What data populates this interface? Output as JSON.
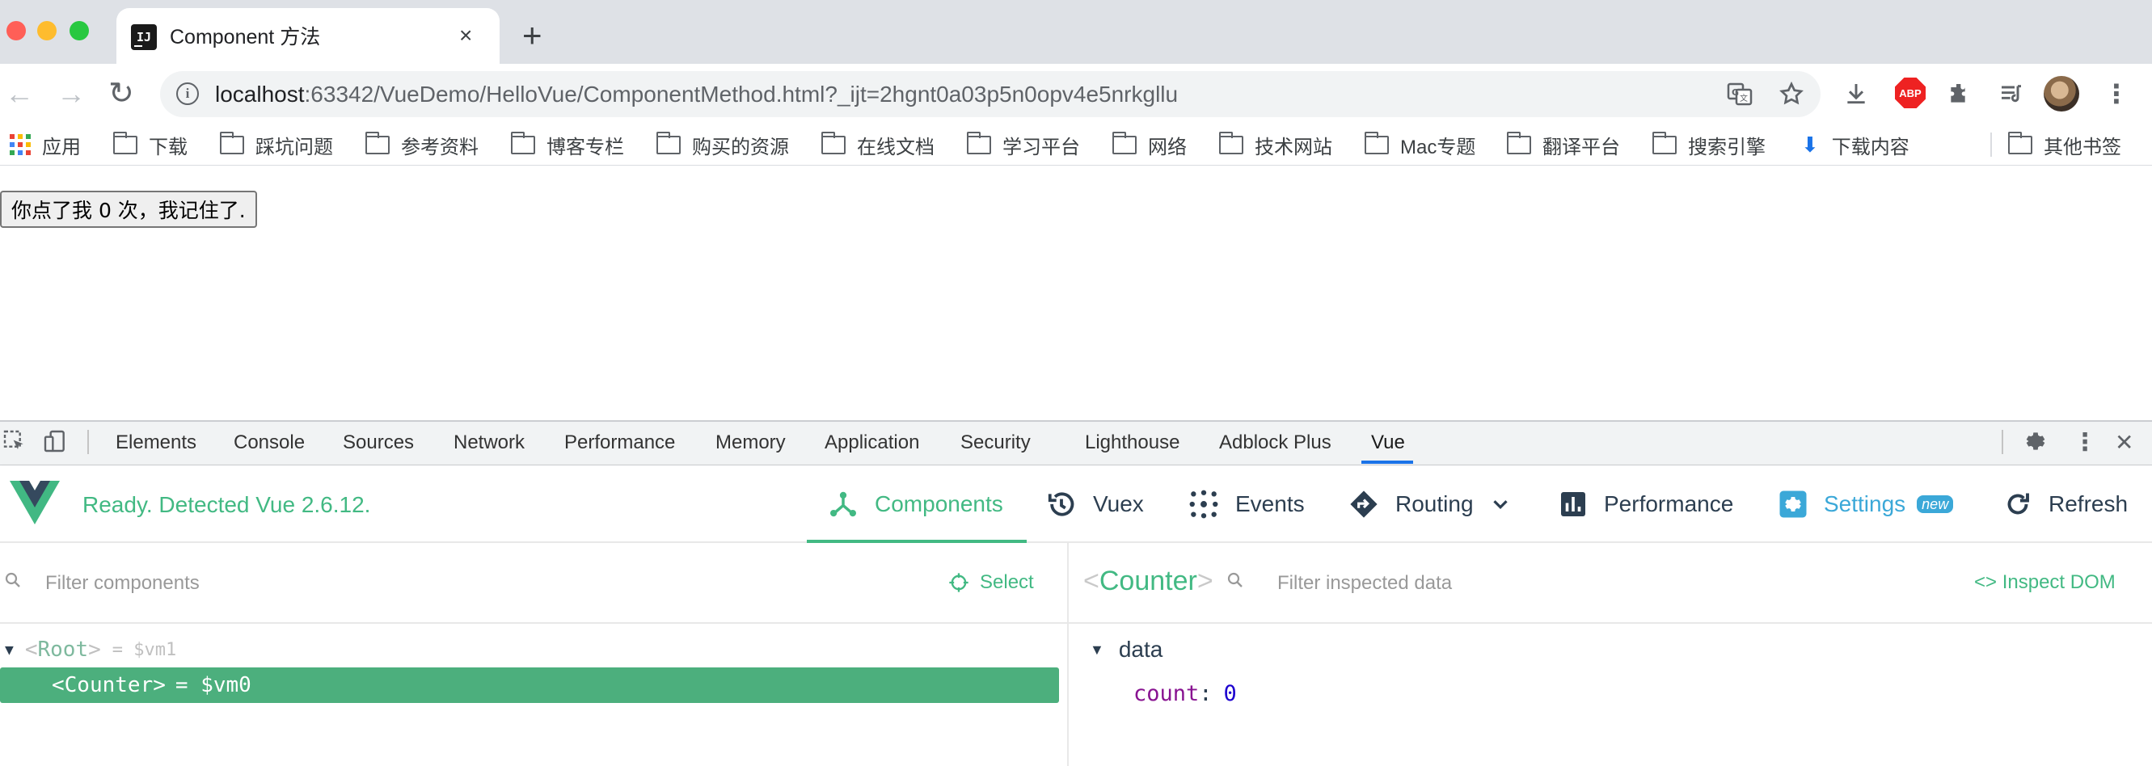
{
  "window": {
    "traffic_lights": [
      "#ff5f57",
      "#febc2e",
      "#28c840"
    ]
  },
  "tab": {
    "title": "Component 方法",
    "favicon": "IJ",
    "close": "×",
    "new_tab": "+"
  },
  "toolbar": {
    "back": "←",
    "forward": "→",
    "reload": "↻",
    "url_host": "localhost",
    "url_rest": ":63342/VueDemo/HelloVue/ComponentMethod.html?_ijt=2hgnt0a03p5n0opv4e5nrkgllu",
    "abp_label": "ABP",
    "icons": [
      "translate-icon",
      "star-icon",
      "download-icon",
      "adblock-icon",
      "extensions-icon",
      "reading-list-icon",
      "avatar",
      "kebab-menu-icon"
    ]
  },
  "bookmarks": {
    "apps": "应用",
    "folders": [
      "下载",
      "踩坑问题",
      "参考资料",
      "博客专栏",
      "购买的资源",
      "在线文档",
      "学习平台",
      "网络",
      "技术网站",
      "Mac专题",
      "翻译平台",
      "搜索引擎"
    ],
    "download": "下载内容",
    "other": "其他书签"
  },
  "page": {
    "button_label": "你点了我 0 次，我记住了."
  },
  "devtools": {
    "tabs": [
      "Elements",
      "Console",
      "Sources",
      "Network",
      "Performance",
      "Memory",
      "Application",
      "Security",
      "Lighthouse",
      "Adblock Plus",
      "Vue"
    ],
    "active_tab": "Vue",
    "close": "✕"
  },
  "vue": {
    "status": "Ready. Detected Vue 2.6.12.",
    "nav": {
      "components": "Components",
      "vuex": "Vuex",
      "events": "Events",
      "routing": "Routing",
      "performance": "Performance",
      "settings": "Settings",
      "settings_badge": "new",
      "refresh": "Refresh"
    },
    "colors": {
      "accent": "#42b983",
      "settings": "#3ba8d8",
      "selected_row": "#4caf7d"
    },
    "components_pane": {
      "filter_placeholder": "Filter components",
      "select_label": "Select",
      "tree": {
        "root_open": "<",
        "root_name": "Root",
        "root_close": ">",
        "root_vm": "= $vm1",
        "child": "<Counter>",
        "child_vm": "= $vm0"
      }
    },
    "inspector": {
      "open": "<",
      "name": "Counter",
      "close": ">",
      "filter_placeholder": "Filter inspected data",
      "inspect_dom": "<> Inspect DOM",
      "section": "data",
      "key": "count",
      "colon": ":",
      "value": "0"
    }
  }
}
